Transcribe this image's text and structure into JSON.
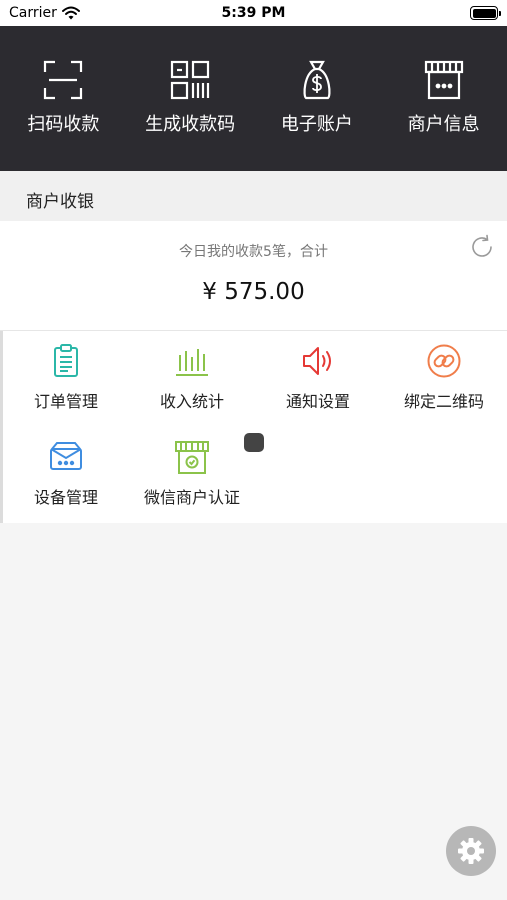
{
  "status_bar": {
    "carrier": "Carrier",
    "time": "5:39 PM"
  },
  "top_menu": [
    {
      "label": "扫码收款",
      "icon": "scan-icon"
    },
    {
      "label": "生成收款码",
      "icon": "qr-code-icon"
    },
    {
      "label": "电子账户",
      "icon": "money-bag-icon"
    },
    {
      "label": "商户信息",
      "icon": "storefront-icon"
    }
  ],
  "section": {
    "title": "商户收银"
  },
  "summary": {
    "description": "今日我的收款5笔，合计",
    "amount": "¥ 575.00"
  },
  "functions": [
    {
      "label": "订单管理",
      "icon": "clipboard-icon",
      "color": "#2bb7a8"
    },
    {
      "label": "收入统计",
      "icon": "bar-stats-icon",
      "color": "#8bc34a"
    },
    {
      "label": "通知设置",
      "icon": "speaker-icon",
      "color": "#e53935"
    },
    {
      "label": "绑定二维码",
      "icon": "link-icon",
      "color": "#f07d4a"
    },
    {
      "label": "设备管理",
      "icon": "device-icon",
      "color": "#3f8de0"
    },
    {
      "label": "微信商户认证",
      "icon": "verified-store-icon",
      "color": "#8bc34a"
    }
  ]
}
